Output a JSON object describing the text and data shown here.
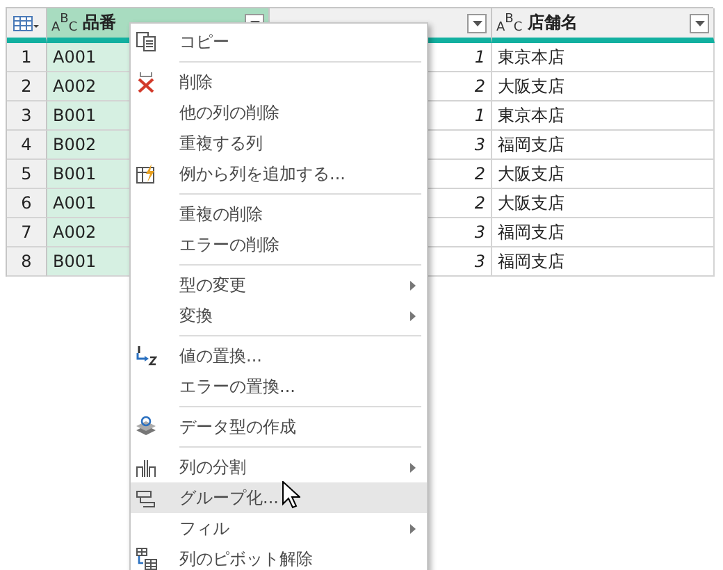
{
  "table": {
    "columns": [
      {
        "label": "品番",
        "type_mark": "ABC",
        "selected": true
      },
      {
        "selected": false
      },
      {
        "label": "店舗名",
        "type_mark": "ABC",
        "selected": false
      }
    ],
    "rows": [
      {
        "index": "1",
        "cells": [
          "A001",
          "1",
          "東京本店"
        ]
      },
      {
        "index": "2",
        "cells": [
          "A002",
          "2",
          "大阪支店"
        ]
      },
      {
        "index": "3",
        "cells": [
          "B001",
          "1",
          "東京本店"
        ]
      },
      {
        "index": "4",
        "cells": [
          "B002",
          "3",
          "福岡支店"
        ]
      },
      {
        "index": "5",
        "cells": [
          "B001",
          "2",
          "大阪支店"
        ]
      },
      {
        "index": "6",
        "cells": [
          "A001",
          "2",
          "大阪支店"
        ]
      },
      {
        "index": "7",
        "cells": [
          "A002",
          "3",
          "福岡支店"
        ]
      },
      {
        "index": "8",
        "cells": [
          "B001",
          "3",
          "福岡支店"
        ]
      }
    ]
  },
  "context_menu": {
    "items": [
      {
        "kind": "item",
        "label": "コピー",
        "submenu": false,
        "selected": false
      },
      {
        "kind": "separator"
      },
      {
        "kind": "item",
        "label": "削除",
        "submenu": false,
        "selected": false
      },
      {
        "kind": "item",
        "label": "他の列の削除",
        "submenu": false,
        "selected": false
      },
      {
        "kind": "item",
        "label": "重複する列",
        "submenu": false,
        "selected": false
      },
      {
        "kind": "item",
        "label": "例から列を追加する...",
        "submenu": false,
        "selected": false
      },
      {
        "kind": "separator"
      },
      {
        "kind": "item",
        "label": "重複の削除",
        "submenu": false,
        "selected": false
      },
      {
        "kind": "item",
        "label": "エラーの削除",
        "submenu": false,
        "selected": false
      },
      {
        "kind": "separator"
      },
      {
        "kind": "item",
        "label": "型の変更",
        "submenu": true,
        "selected": false
      },
      {
        "kind": "item",
        "label": "変換",
        "submenu": true,
        "selected": false
      },
      {
        "kind": "separator"
      },
      {
        "kind": "item",
        "label": "値の置換...",
        "submenu": false,
        "selected": false
      },
      {
        "kind": "item",
        "label": "エラーの置換...",
        "submenu": false,
        "selected": false
      },
      {
        "kind": "separator"
      },
      {
        "kind": "item",
        "label": "データ型の作成",
        "submenu": false,
        "selected": false
      },
      {
        "kind": "separator"
      },
      {
        "kind": "item",
        "label": "列の分割",
        "submenu": true,
        "selected": false
      },
      {
        "kind": "item",
        "label": "グループ化...",
        "submenu": false,
        "selected": true
      },
      {
        "kind": "item",
        "label": "フィル",
        "submenu": true,
        "selected": false
      },
      {
        "kind": "item",
        "label": "列のピボット解除",
        "submenu": false,
        "selected": false
      }
    ]
  }
}
